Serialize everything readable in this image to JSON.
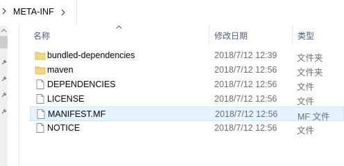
{
  "breadcrumb": {
    "items": [
      "META-INF"
    ]
  },
  "columns": {
    "name": "名称",
    "modified": "修改日期",
    "type": "类型"
  },
  "files": [
    {
      "name": "bundled-dependencies",
      "modified": "2018/7/12 12:39",
      "type": "文件夹",
      "icon": "folder-icon"
    },
    {
      "name": "maven",
      "modified": "2018/7/12 12:56",
      "type": "文件夹",
      "icon": "folder-icon"
    },
    {
      "name": "DEPENDENCIES",
      "modified": "2018/7/12 12:56",
      "type": "文件",
      "icon": "file-icon"
    },
    {
      "name": "LICENSE",
      "modified": "2018/7/12 12:56",
      "type": "文件",
      "icon": "file-icon"
    },
    {
      "name": "MANIFEST.MF",
      "modified": "2018/7/12 12:56",
      "type": "MF 文件",
      "icon": "file-icon",
      "selected": true
    },
    {
      "name": "NOTICE",
      "modified": "2018/7/12 12:56",
      "type": "文件",
      "icon": "file-icon"
    }
  ],
  "colors": {
    "folder": "#f8d775",
    "selection": "#e5f3ff",
    "header_text": "#4c607a"
  }
}
